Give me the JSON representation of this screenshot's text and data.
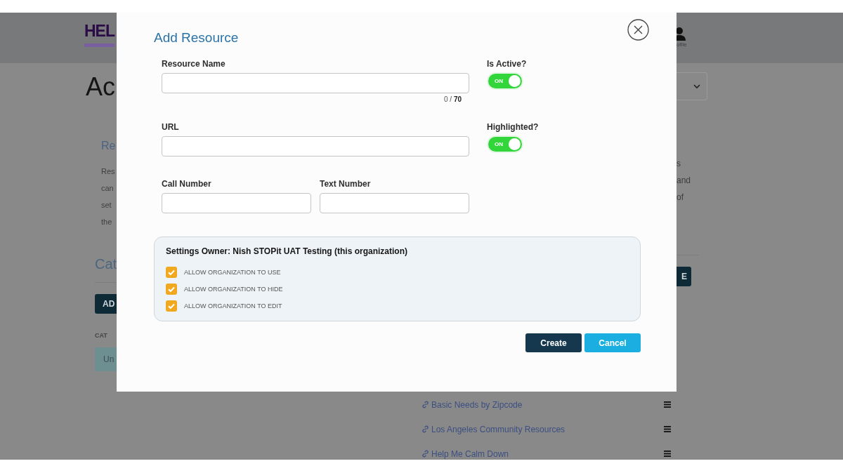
{
  "background_page": {
    "logo": "HEL",
    "profile_label": "ofile",
    "heading": "Ac",
    "section_heading": "Re",
    "paragraph_lines": [
      "Res",
      "can",
      "set",
      "the"
    ],
    "right_paragraph_lines": [
      "s",
      "and",
      "of"
    ],
    "categories_heading": "Cat",
    "add_button": "AD",
    "right_button": "E",
    "column_header": "CAT",
    "row_cell": "Un",
    "links": [
      {
        "label": "Basic Needs by Zipcode"
      },
      {
        "label": "Los Angeles Community Resources"
      },
      {
        "label": "Help Me Calm Down"
      }
    ]
  },
  "dialog": {
    "title": "Add Resource",
    "resource_name": {
      "label": "Resource Name",
      "counter": "0 / **70**"
    },
    "url": {
      "label": "URL"
    },
    "call_number": {
      "label": "Call Number"
    },
    "text_number": {
      "label": "Text Number"
    },
    "toggles": [
      {
        "label": "Is Active?",
        "on": true,
        "text": "ON"
      },
      {
        "label": "Highlighted?",
        "on": true,
        "text": "ON"
      }
    ],
    "settings": {
      "title": "Settings Owner: Nish STOPit UAT Testing (this organization)",
      "permissions": [
        {
          "label": "ALLOW ORGANIZATION TO USE",
          "checked": true
        },
        {
          "label": "ALLOW ORGANIZATION TO HIDE",
          "checked": true
        },
        {
          "label": "ALLOW ORGANIZATION TO EDIT",
          "checked": true
        }
      ]
    },
    "buttons": [
      {
        "label": "Create",
        "kind": "primary"
      },
      {
        "label": "Cancel",
        "kind": "secondary"
      }
    ]
  }
}
